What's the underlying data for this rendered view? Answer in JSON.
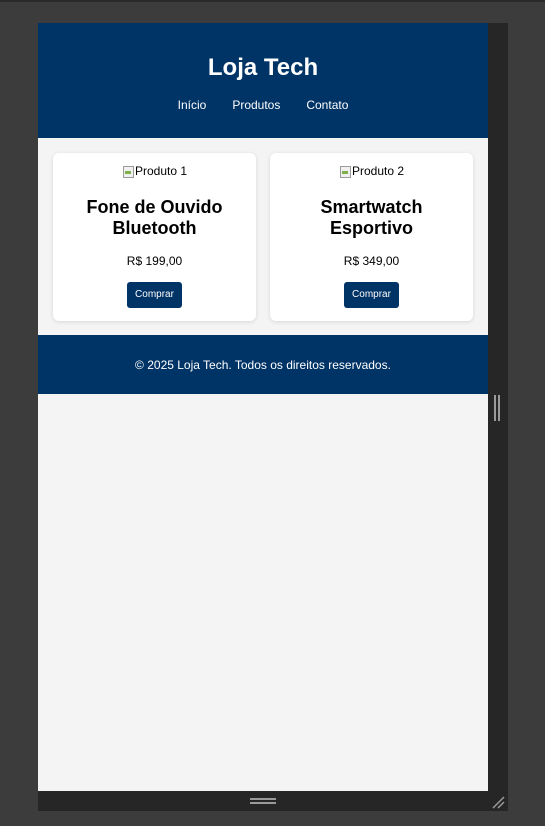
{
  "header": {
    "title": "Loja Tech",
    "nav": [
      "Início",
      "Produtos",
      "Contato"
    ]
  },
  "products": [
    {
      "image_alt": "Produto 1",
      "name": "Fone de Ouvido Bluetooth",
      "price": "R$ 199,00",
      "button": "Comprar"
    },
    {
      "image_alt": "Produto 2",
      "name": "Smartwatch Esportivo",
      "price": "R$ 349,00",
      "button": "Comprar"
    }
  ],
  "footer": {
    "text": "© 2025 Loja Tech. Todos os direitos reservados."
  },
  "colors": {
    "brand": "#003366",
    "page_bg": "#f4f4f4",
    "card_bg": "#ffffff",
    "chrome": "#3c3c3c"
  },
  "icons": [
    "broken-image-icon",
    "resize-handle-icon",
    "resize-corner-icon"
  ]
}
